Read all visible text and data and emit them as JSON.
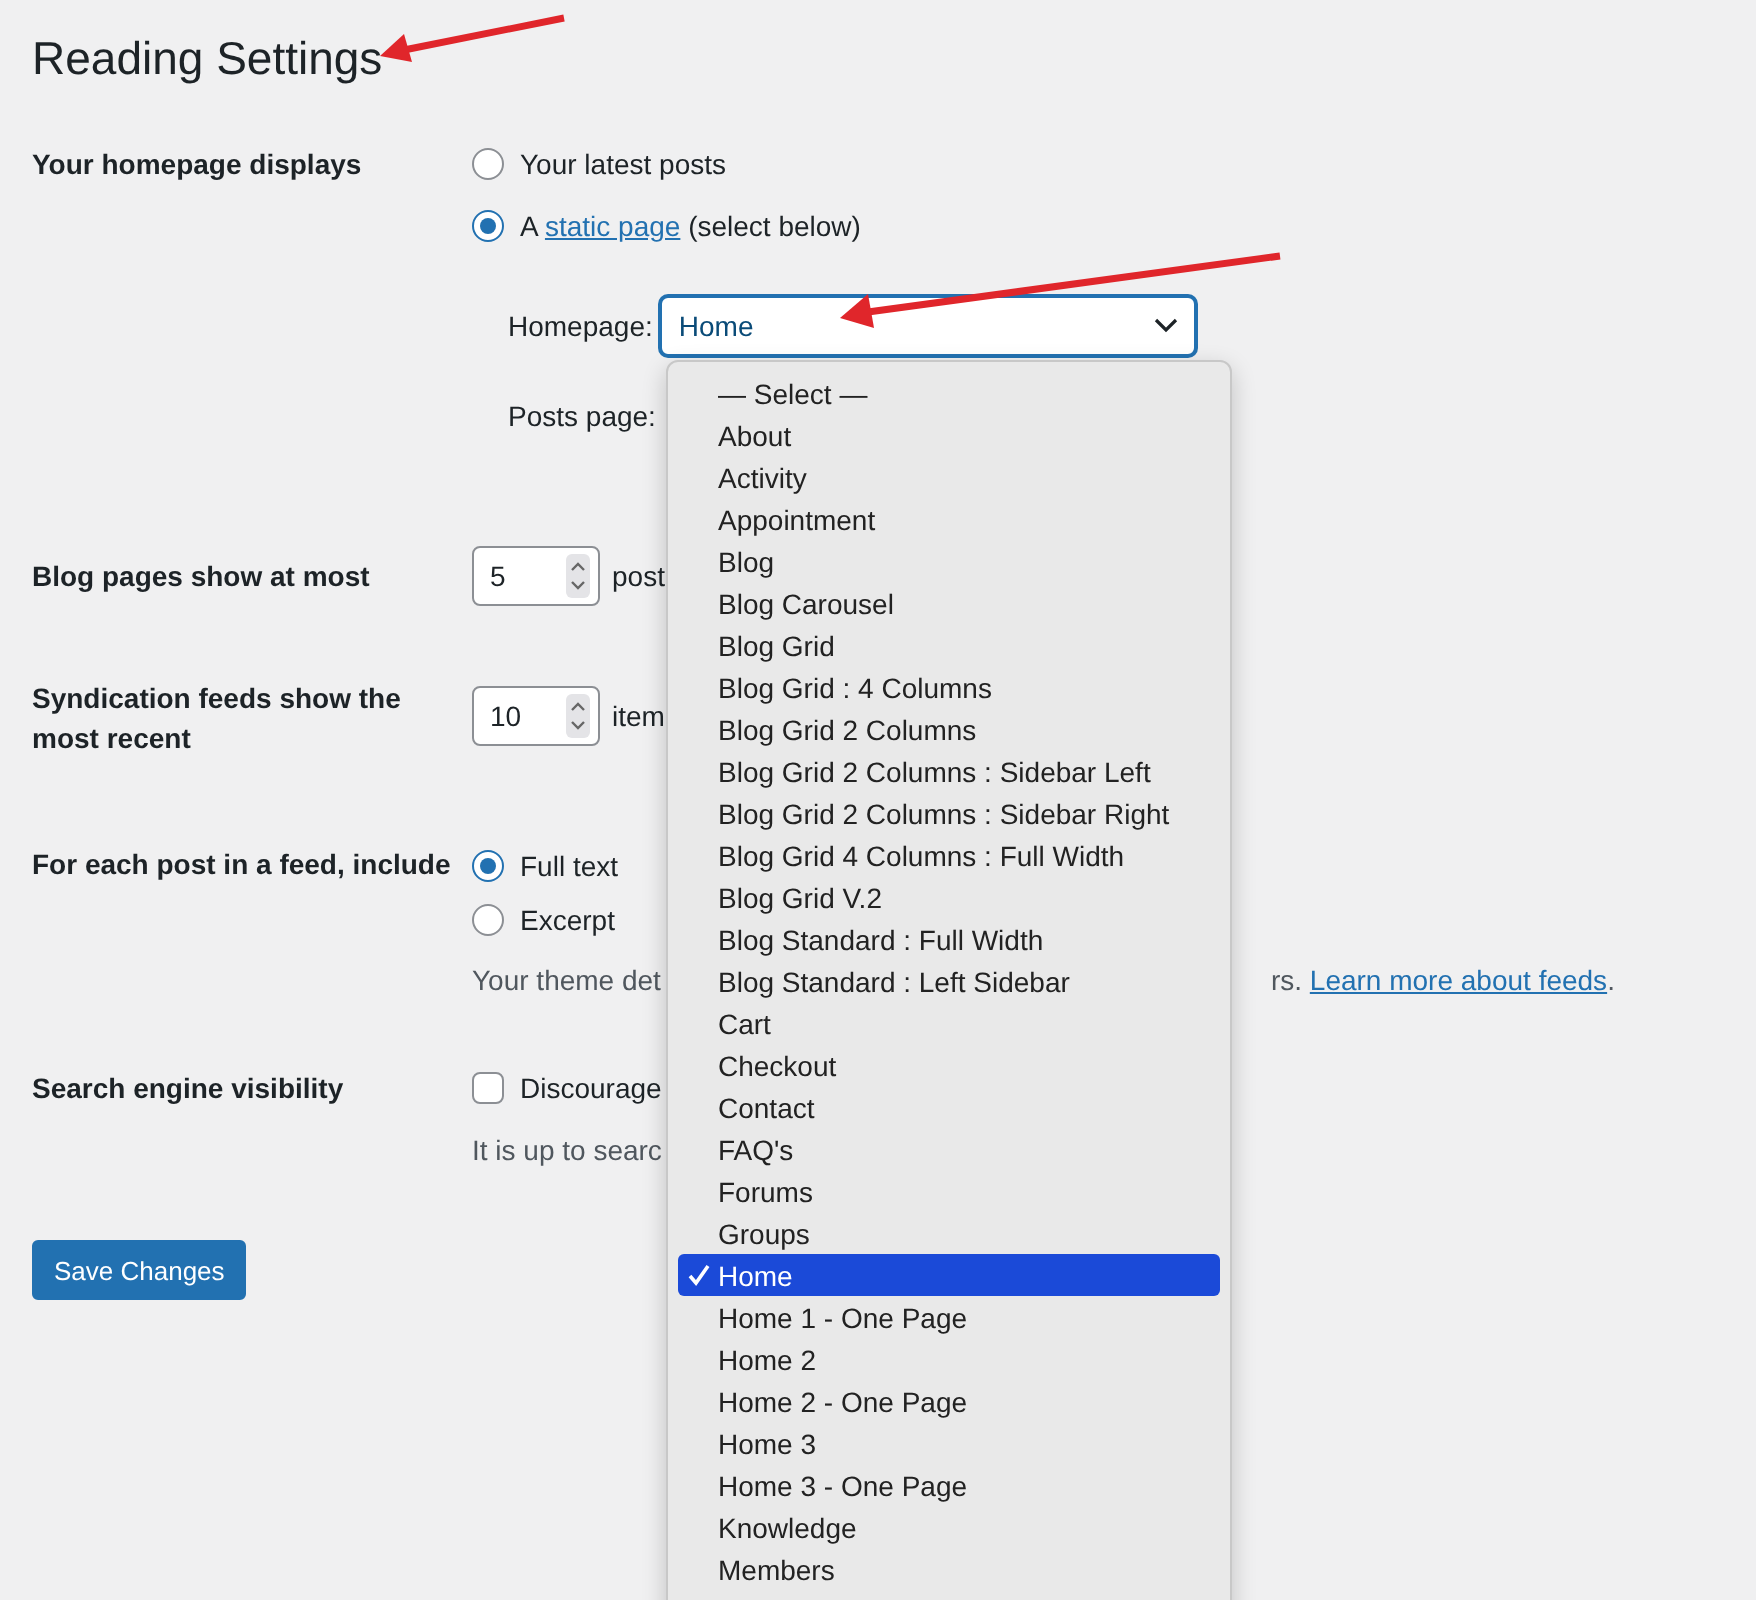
{
  "title": "Reading Settings",
  "homepage_displays": {
    "label": "Your homepage displays",
    "options": [
      {
        "kind": "plain",
        "label": "Your latest posts",
        "selected": false
      },
      {
        "kind": "linked",
        "prefix": "A",
        "link": "static page",
        "suffix": "(select below)",
        "selected": true
      }
    ]
  },
  "homepage_select": {
    "label": "Homepage:",
    "value": "Home"
  },
  "posts_page": {
    "label": "Posts page:"
  },
  "blog_pages": {
    "label": "Blog pages show at most",
    "value": "5",
    "unit": "post"
  },
  "syndication": {
    "label": "Syndication feeds show the most recent",
    "value": "10",
    "unit": "item"
  },
  "feed_content": {
    "label": "For each post in a feed, include",
    "options": [
      {
        "label": "Full text",
        "selected": true
      },
      {
        "label": "Excerpt",
        "selected": false
      }
    ],
    "description_start": "Your theme det",
    "description_end": "rs.",
    "link": "Learn more about feeds",
    "description_tail": "."
  },
  "search_visibility": {
    "label": "Search engine visibility",
    "checkbox": {
      "label": "Discourage",
      "checked": false
    },
    "note": "It is up to searc"
  },
  "save_button": "Save Changes",
  "dropdown": {
    "options": [
      {
        "label": "— Select —",
        "selected": false
      },
      {
        "label": "About",
        "selected": false
      },
      {
        "label": "Activity",
        "selected": false
      },
      {
        "label": "Appointment",
        "selected": false
      },
      {
        "label": "Blog",
        "selected": false
      },
      {
        "label": "Blog Carousel",
        "selected": false
      },
      {
        "label": "Blog Grid",
        "selected": false
      },
      {
        "label": "Blog Grid : 4 Columns",
        "selected": false
      },
      {
        "label": "Blog Grid 2 Columns",
        "selected": false
      },
      {
        "label": "Blog Grid 2 Columns : Sidebar Left",
        "selected": false
      },
      {
        "label": "Blog Grid 2 Columns : Sidebar Right",
        "selected": false
      },
      {
        "label": "Blog Grid 4 Columns : Full Width",
        "selected": false
      },
      {
        "label": "Blog Grid V.2",
        "selected": false
      },
      {
        "label": "Blog Standard : Full Width",
        "selected": false
      },
      {
        "label": "Blog Standard : Left Sidebar",
        "selected": false
      },
      {
        "label": "Cart",
        "selected": false
      },
      {
        "label": "Checkout",
        "selected": false
      },
      {
        "label": "Contact",
        "selected": false
      },
      {
        "label": "FAQ's",
        "selected": false
      },
      {
        "label": "Forums",
        "selected": false
      },
      {
        "label": "Groups",
        "selected": false
      },
      {
        "label": "Home",
        "selected": true
      },
      {
        "label": "Home 1 - One Page",
        "selected": false
      },
      {
        "label": "Home 2",
        "selected": false
      },
      {
        "label": "Home 2 - One Page",
        "selected": false
      },
      {
        "label": "Home 3",
        "selected": false
      },
      {
        "label": "Home 3 - One Page",
        "selected": false
      },
      {
        "label": "Knowledge",
        "selected": false
      },
      {
        "label": "Members",
        "selected": false
      }
    ]
  }
}
